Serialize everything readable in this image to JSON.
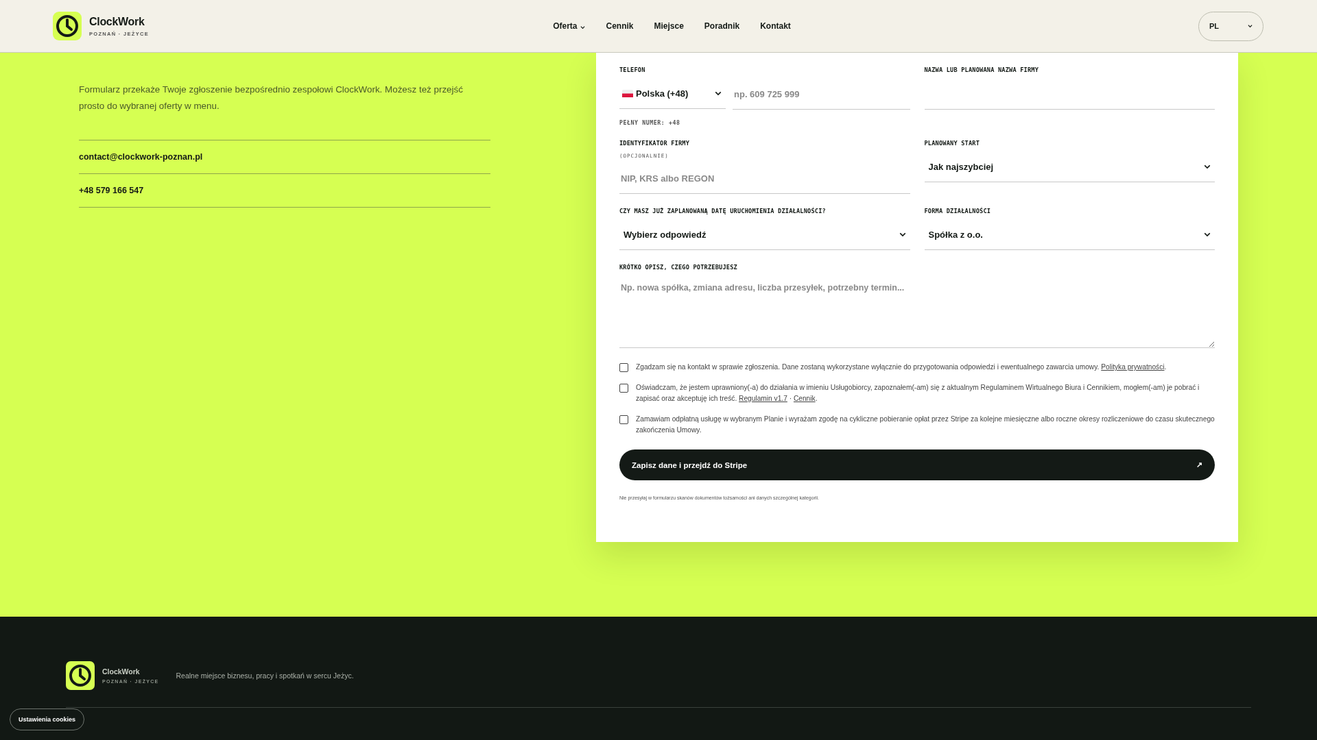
{
  "header": {
    "brand": {
      "name": "ClockWork",
      "subtitle": "POZNAŃ · JEŻYCE"
    },
    "nav": [
      {
        "label": "Oferta",
        "kind": "menu"
      },
      {
        "label": "Cennik",
        "kind": "link"
      },
      {
        "label": "Miejsce",
        "kind": "link"
      },
      {
        "label": "Poradnik",
        "kind": "link"
      },
      {
        "label": "Kontakt",
        "kind": "link"
      }
    ],
    "language": {
      "value": "PL"
    }
  },
  "intro": {
    "paragraph": "Formularz przekaże Twoje zgłoszenie bezpośrednio zespołowi ClockWork. Możesz też przejść prosto do wybranej oferty w menu.",
    "contacts": [
      "contact@clockwork-poznan.pl",
      "+48 579 166 547"
    ]
  },
  "form": {
    "fields": [
      {
        "kind": "phone",
        "label": "TELEFON",
        "country": "Polska (+48)",
        "placeholder": "np. 609 725 999",
        "hint": "PEŁNY NUMER: +48"
      },
      {
        "kind": "text",
        "label": "NAZWA LUB PLANOWANA NAZWA FIRMY"
      },
      {
        "kind": "text",
        "label": "IDENTYFIKATOR FIRMY",
        "note": "(OPCJONALNIE)",
        "placeholder": "NIP, KRS albo REGON"
      },
      {
        "kind": "select",
        "label": "PLANOWANY START",
        "value": "Jak najszybciej"
      },
      {
        "kind": "select",
        "label": "CZY MASZ JUŻ ZAPLANOWANĄ DATĘ URUCHOMIENIA DZIAŁALNOŚCI?",
        "value": "Wybierz odpowiedź"
      },
      {
        "kind": "select",
        "label": "FORMA DZIAŁALNOŚCI",
        "value": "Spółka z o.o."
      },
      {
        "kind": "textarea",
        "label": "KRÓTKO OPISZ, CZEGO POTRZEBUJESZ",
        "placeholder": "Np. nowa spółka, zmiana adresu, liczba przesyłek, potrzebny termin..."
      }
    ],
    "consents": [
      {
        "checked": false,
        "parts": [
          {
            "kind": "plain",
            "text": "Zgadzam się na kontakt w sprawie zgłoszenia. Dane zostaną wykorzystane wyłącznie do przygotowania odpowiedzi i ewentualnego zawarcia umowy. "
          },
          {
            "kind": "link",
            "text": "Polityka prywatności"
          },
          {
            "kind": "plain",
            "text": "."
          }
        ]
      },
      {
        "checked": false,
        "parts": [
          {
            "kind": "plain",
            "text": "Oświadczam, że jestem uprawniony(-a) do działania w imieniu Usługobiorcy, zapoznałem(-am) się z aktualnym Regulaminem Wirtualnego Biura i Cennikiem, mogłem(-am) je pobrać i zapisać oraz akceptuję ich treść. "
          },
          {
            "kind": "link",
            "text": "Regulamin v1.7"
          },
          {
            "kind": "plain",
            "text": " · "
          },
          {
            "kind": "link",
            "text": "Cennik"
          },
          {
            "kind": "plain",
            "text": "."
          }
        ]
      },
      {
        "checked": false,
        "parts": [
          {
            "kind": "plain",
            "text": "Zamawiam odpłatną usługę w wybranym Planie i wyrażam zgodę na cykliczne pobieranie opłat przez Stripe za kolejne miesięczne albo roczne okresy rozliczeniowe do czasu skutecznego zakończenia Umowy."
          }
        ]
      }
    ],
    "submit": {
      "label": "Zapisz dane i przejdź do Stripe",
      "arrow": "↗"
    },
    "note": "Nie przesyłaj w formularzu skanów dokumentów tożsamości ani danych szczególnej kategorii."
  },
  "footer": {
    "brand": {
      "name": "ClockWork",
      "subtitle": "POZNAŃ · JEŻYCE"
    },
    "tagline": "Realne miejsce biznesu, pracy i spotkań w sercu Jeżyc.",
    "cookie_button": "Ustawienia cookies"
  }
}
